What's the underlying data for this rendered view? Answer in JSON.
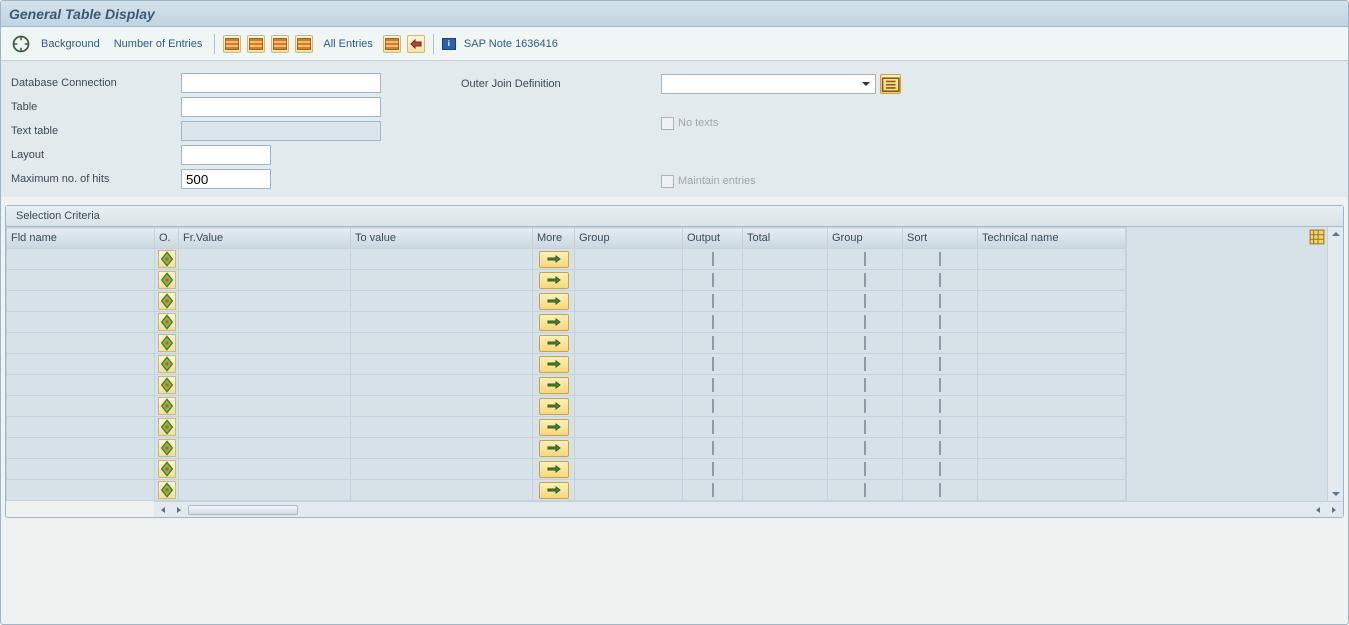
{
  "title": "General Table Display",
  "toolbar": {
    "background_label": "Background",
    "num_entries_label": "Number of Entries",
    "all_entries_label": "All Entries",
    "sap_note_label": "SAP Note 1636416"
  },
  "form": {
    "db_conn_label": "Database Connection",
    "db_conn_value": "",
    "table_label": "Table",
    "table_value": "",
    "text_table_label": "Text table",
    "text_table_value": "",
    "layout_label": "Layout",
    "layout_value": "",
    "max_hits_label": "Maximum no. of hits",
    "max_hits_value": "500",
    "ojd_label": "Outer Join Definition",
    "ojd_value": "",
    "no_texts_label": "No texts",
    "maintain_label": "Maintain entries"
  },
  "grid": {
    "title": "Selection Criteria",
    "headers": {
      "fld_name": "Fld name",
      "option": "O.",
      "fr_value": "Fr.Value",
      "to_value": "To value",
      "more": "More",
      "group_entry": "Group",
      "output": "Output",
      "total": "Total",
      "group_cb": "Group",
      "sort": "Sort",
      "tech_name": "Technical name"
    },
    "row_count": 12
  }
}
